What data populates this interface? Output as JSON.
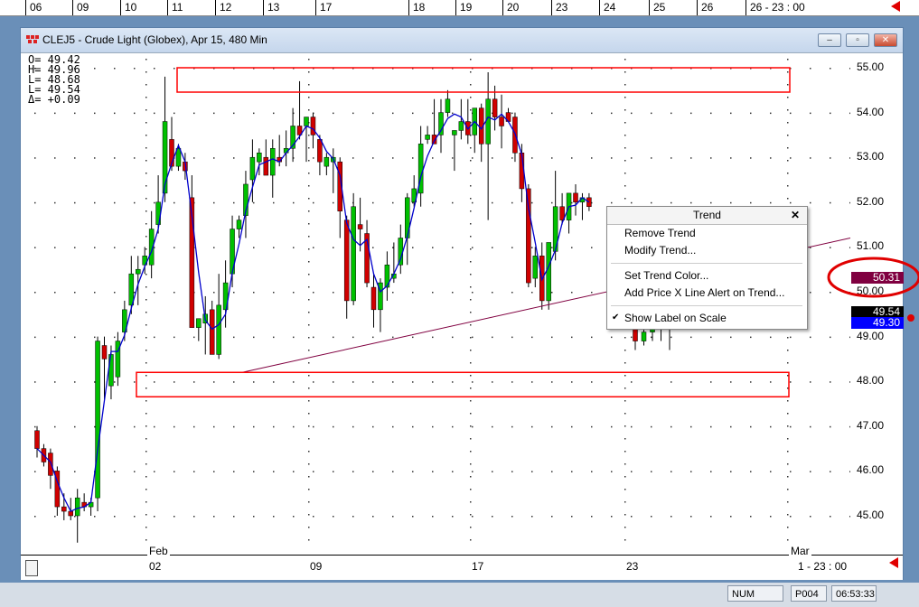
{
  "top_axis": {
    "labels": [
      "06",
      "09",
      "10",
      "11",
      "12",
      "13",
      "17",
      "18",
      "19",
      "20",
      "23",
      "24",
      "25",
      "26",
      "26 - 23 : 00"
    ]
  },
  "window": {
    "title": "CLEJ5 - Crude Light (Globex), Apr 15, 480 Min",
    "minimize": "–",
    "restore": "▫",
    "close": "✕"
  },
  "ohlc": {
    "o": "O=   49.42",
    "h": "H=   49.96",
    "l1": "L=   48.68",
    "l2": "L=   49.54",
    "d": "Δ=   +0.09"
  },
  "price_axis": {
    "labels": [
      "55.00",
      "54.00",
      "53.00",
      "52.00",
      "51.00",
      "50.00",
      "49.00",
      "48.00",
      "47.00",
      "46.00",
      "45.00"
    ],
    "trend_label": "50.31",
    "last_label": "49.54",
    "current_label": "49.30"
  },
  "time_axis": {
    "labels": [
      "Feb",
      "02",
      "09",
      "17",
      "23",
      "Mar",
      "1 - 23 : 00"
    ]
  },
  "context_menu": {
    "header": "Trend",
    "close": "✕",
    "items": [
      "Remove Trend",
      "Modify Trend...",
      "Set Trend Color...",
      "Add Price X Line Alert on Trend...",
      "Show Label on Scale"
    ],
    "checkmark": "✔"
  },
  "status_bar": {
    "num": "NUM",
    "page": "P004",
    "time": "06:53:33"
  },
  "colors": {
    "up": "#00c000",
    "down": "#d00000",
    "ma": "#0000cc",
    "trend": "#800040",
    "box": "#ff0000",
    "trend_label_bg": "#800040",
    "current_bg": "#0000ff"
  }
}
